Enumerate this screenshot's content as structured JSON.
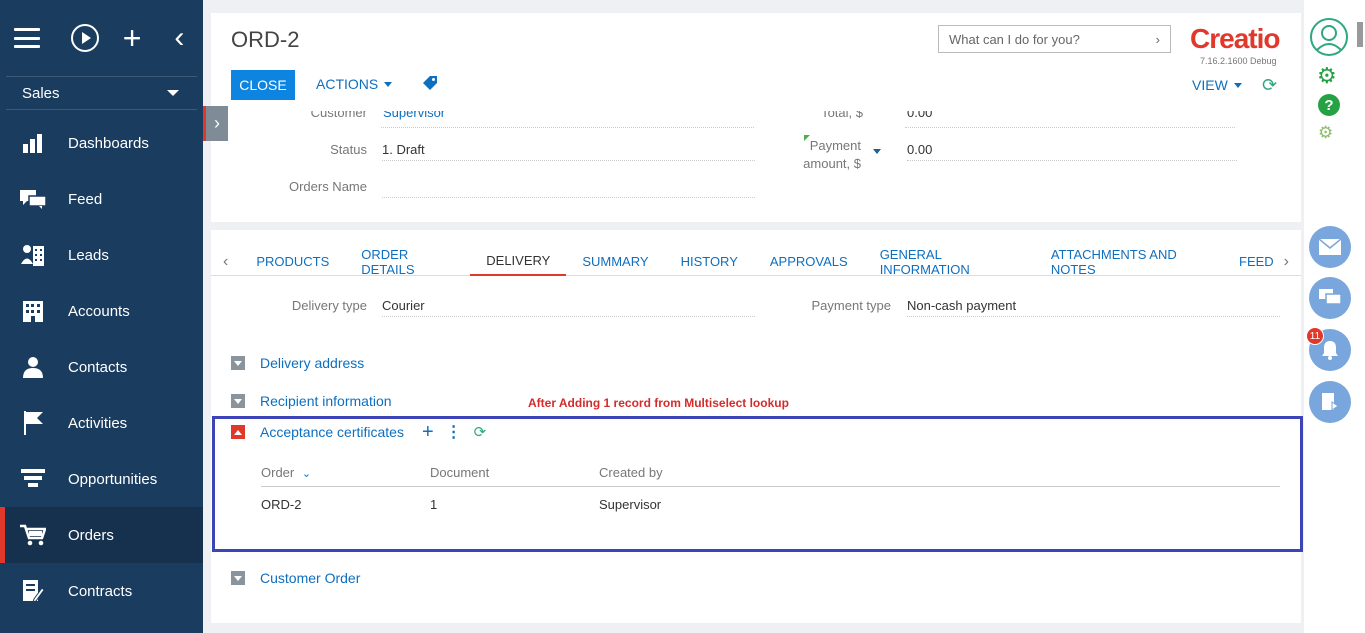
{
  "sidebar": {
    "section": "Sales",
    "items": [
      {
        "label": "Dashboards",
        "icon": "bar-chart-icon"
      },
      {
        "label": "Feed",
        "icon": "chat-bubbles-icon"
      },
      {
        "label": "Leads",
        "icon": "lead-building-icon"
      },
      {
        "label": "Accounts",
        "icon": "building-icon"
      },
      {
        "label": "Contacts",
        "icon": "person-icon"
      },
      {
        "label": "Activities",
        "icon": "flag-icon"
      },
      {
        "label": "Opportunities",
        "icon": "funnel-icon"
      },
      {
        "label": "Orders",
        "icon": "cart-icon"
      },
      {
        "label": "Contracts",
        "icon": "contract-pen-icon"
      }
    ]
  },
  "header": {
    "title": "ORD-2",
    "close_label": "CLOSE",
    "actions_label": "ACTIONS",
    "search_placeholder": "What can I do for you?",
    "logo": "Creatio",
    "version": "7.16.2.1600 Debug",
    "view_label": "VIEW"
  },
  "fields": {
    "customer_label": "Customer",
    "customer_value": "Supervisor",
    "status_label": "Status",
    "status_value": "1. Draft",
    "orders_name_label": "Orders Name",
    "total_label": "Total, $",
    "total_value": "0.00",
    "payment_amount_label_1": "Payment",
    "payment_amount_label_2": "amount, $",
    "payment_amount_value": "0.00"
  },
  "tabs": [
    "PRODUCTS",
    "ORDER DETAILS",
    "DELIVERY",
    "SUMMARY",
    "HISTORY",
    "APPROVALS",
    "GENERAL INFORMATION",
    "ATTACHMENTS AND NOTES",
    "FEED"
  ],
  "active_tab": "DELIVERY",
  "delivery": {
    "delivery_type_label": "Delivery type",
    "delivery_type_value": "Courier",
    "payment_type_label": "Payment type",
    "payment_type_value": "Non-cash payment",
    "sections": {
      "delivery_address": "Delivery address",
      "recipient_information": "Recipient information",
      "acceptance_certificates": "Acceptance certificates",
      "customer_order": "Customer Order"
    },
    "annotation": "After Adding 1 record from Multiselect lookup",
    "grid": {
      "columns": [
        "Order",
        "Document",
        "Created by"
      ],
      "rows": [
        [
          "ORD-2",
          "1",
          "Supervisor"
        ]
      ]
    }
  },
  "rightbar": {
    "notification_count": "11"
  },
  "colors": {
    "sidebar_bg": "#1a3c5e",
    "accent_red": "#e0382b",
    "link_blue": "#0e6fbf",
    "button_blue": "#0e84e1",
    "highlight_border": "#3d44b8",
    "green": "#2ea87c"
  }
}
